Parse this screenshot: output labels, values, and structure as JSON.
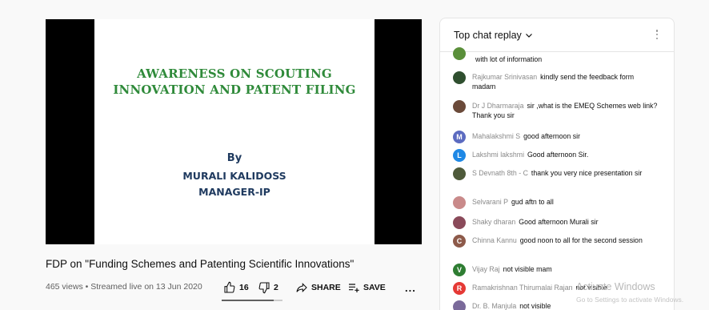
{
  "slide": {
    "title_line1": "AWARENESS ON SCOUTING",
    "title_line2": "INNOVATION AND PATENT FILING",
    "by": "By",
    "name_line1": "MURALI KALIDOSS",
    "name_line2": "MANAGER-IP"
  },
  "video": {
    "title": "FDP on \"Funding Schemes and Patenting Scientific Innovations\"",
    "views": "465 views • Streamed live on 13 Jun 2020",
    "likes": "16",
    "dislikes": "2",
    "share_label": "SHARE",
    "save_label": "SAVE",
    "more_label": "..."
  },
  "chat": {
    "title": "Top chat replay",
    "messages": [
      {
        "author": "",
        "text": "with lot of information",
        "avatar_color": "#5a8f3a",
        "avatar_letter": ""
      },
      {
        "author": "Rajkumar Srinivasan",
        "text": "kindly send the feedback form madam",
        "avatar_color": "#2f4f2f",
        "avatar_letter": ""
      },
      {
        "author": "Dr J Dharmaraja",
        "text": "sir ,what is the EMEQ Schemes web link? Thank you sir",
        "avatar_color": "#6b4a3a",
        "avatar_letter": ""
      },
      {
        "author": "Mahalakshmi S",
        "text": "good afternoon sir",
        "avatar_color": "#5c6bc0",
        "avatar_letter": "M"
      },
      {
        "author": "Lakshmi lakshmi",
        "text": "Good afternoon Sir.",
        "avatar_color": "#1e88e5",
        "avatar_letter": "L"
      },
      {
        "author": "S Devnath 8th - C",
        "text": "thank you very nice presentation sir",
        "avatar_color": "#4e5a3a",
        "avatar_letter": ""
      },
      {
        "author": "Selvarani P",
        "text": "gud aftn to all",
        "avatar_color": "#c98a8a",
        "avatar_letter": ""
      },
      {
        "author": "Shaky dharan",
        "text": "Good afternoon Murali sir",
        "avatar_color": "#8a4a5a",
        "avatar_letter": ""
      },
      {
        "author": "Chinna Kannu",
        "text": "good noon to all for the second session",
        "avatar_color": "#8d5a4a",
        "avatar_letter": "C"
      },
      {
        "author": "Vijay Raj",
        "text": "not visible mam",
        "avatar_color": "#2e7d32",
        "avatar_letter": "V"
      },
      {
        "author": "Ramakrishnan Thirumalai Rajan",
        "text": "not visible",
        "avatar_color": "#e53935",
        "avatar_letter": "R"
      },
      {
        "author": "Dr. B. Manjula",
        "text": "not visible",
        "avatar_color": "#7a6a9a",
        "avatar_letter": ""
      }
    ]
  },
  "overlay": {
    "watermark": "Activate Windows",
    "watermark_sub": "Go to Settings to activate Windows."
  }
}
